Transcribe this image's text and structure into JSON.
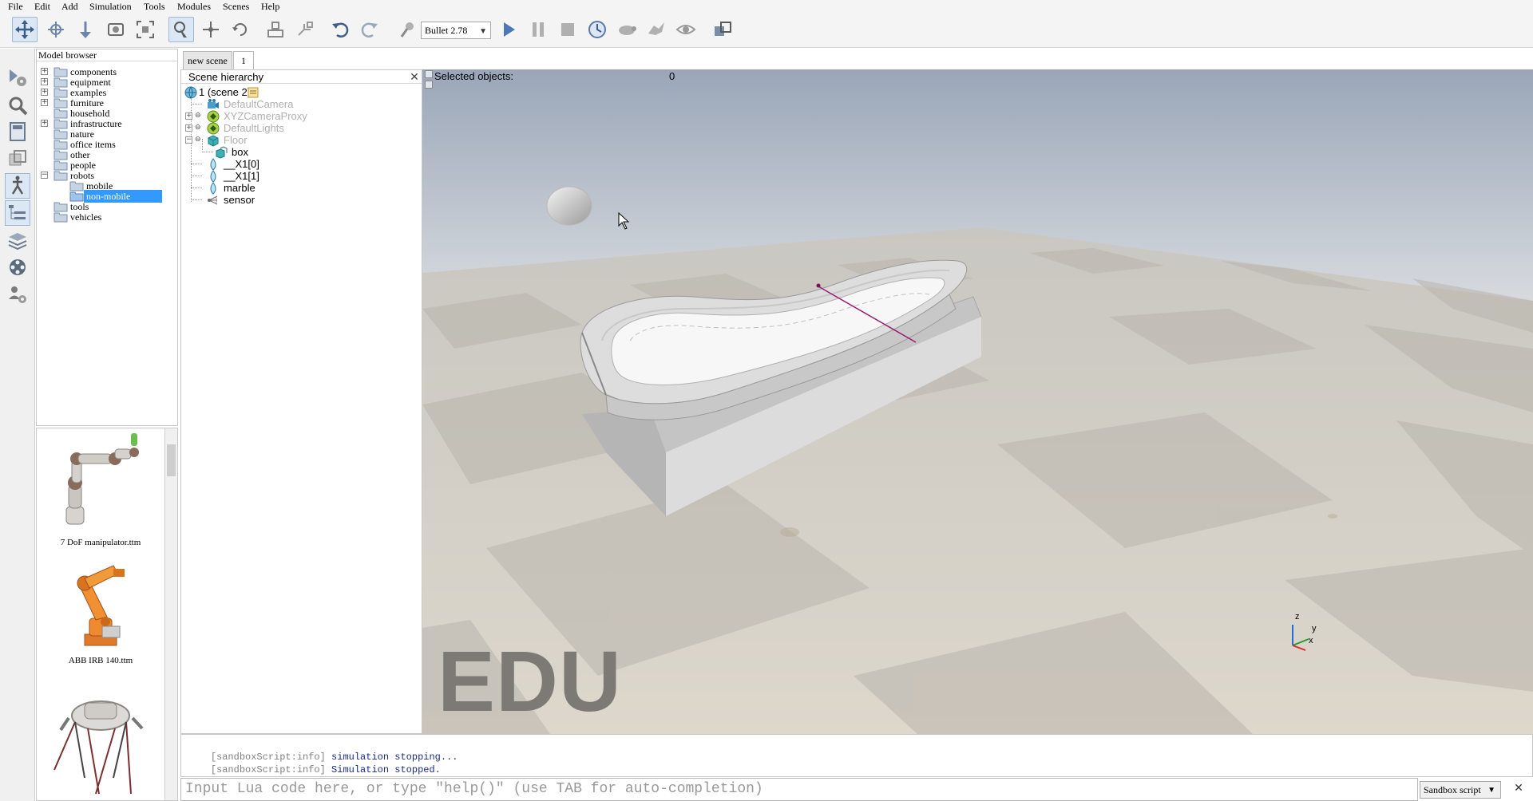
{
  "menu": [
    "File",
    "Edit",
    "Add",
    "Simulation",
    "Tools",
    "Modules",
    "Scenes",
    "Help"
  ],
  "toolbar": {
    "engine": "Bullet 2.78",
    "icons": [
      "camera-pan-icon",
      "camera-rotate-icon",
      "camera-shift-icon",
      "camera-angle-icon",
      "fit-to-view-icon",
      "click-select-icon",
      "object-shift-icon",
      "object-rotate-icon",
      "assemble-icon",
      "transfer-dna-icon",
      "undo-icon",
      "redo-icon",
      "dynamics-settings-icon",
      "start-simulation-icon",
      "pause-simulation-icon",
      "stop-simulation-icon",
      "real-time-icon",
      "slow-down-icon",
      "speed-up-icon",
      "visualization-icon",
      "page-selector-icon"
    ]
  },
  "left_toolbar": [
    "simulation-settings-icon",
    "object-properties-icon",
    "calculation-modules-icon",
    "collections-icon",
    "scripts-icon",
    "shapes-edit-icon",
    "layers-icon",
    "video-recorder-icon",
    "user-settings-icon"
  ],
  "model_browser": {
    "title": "Model browser",
    "folders": [
      {
        "label": "components",
        "expandable": true
      },
      {
        "label": "equipment",
        "expandable": true
      },
      {
        "label": "examples",
        "expandable": true
      },
      {
        "label": "furniture",
        "expandable": true
      },
      {
        "label": "household",
        "expandable": false
      },
      {
        "label": "infrastructure",
        "expandable": true
      },
      {
        "label": "nature",
        "expandable": false
      },
      {
        "label": "office items",
        "expandable": false
      },
      {
        "label": "other",
        "expandable": false
      },
      {
        "label": "people",
        "expandable": false
      },
      {
        "label": "robots",
        "expandable": true,
        "expanded": true
      },
      {
        "label": "mobile",
        "child": true
      },
      {
        "label": "non-mobile",
        "child": true,
        "selected": true
      },
      {
        "label": "tools",
        "expandable": false
      },
      {
        "label": "vehicles",
        "expandable": false
      }
    ],
    "thumbnails": [
      {
        "label": "7 DoF manipulator.ttm"
      },
      {
        "label": "ABB IRB 140.ttm"
      },
      {
        "label": ""
      }
    ]
  },
  "tabs": [
    {
      "label": "new scene",
      "active": false
    },
    {
      "label": "1",
      "active": true
    }
  ],
  "hierarchy": {
    "title": "Scene hierarchy",
    "close": "✕",
    "items": [
      {
        "label": "1 (scene 2)",
        "dim": false
      },
      {
        "label": "DefaultCamera",
        "dim": true
      },
      {
        "label": "XYZCameraProxy",
        "dim": true
      },
      {
        "label": "DefaultLights",
        "dim": true
      },
      {
        "label": "Floor",
        "dim": true
      },
      {
        "label": "box",
        "dim": false
      },
      {
        "label": "__X1[0]",
        "dim": false
      },
      {
        "label": "__X1[1]",
        "dim": false
      },
      {
        "label": "marble",
        "dim": false
      },
      {
        "label": "sensor",
        "dim": false
      }
    ]
  },
  "viewport": {
    "selected_label": "Selected objects:",
    "selected_count": "0",
    "watermark": "EDU",
    "axes": {
      "z": "z",
      "y": "y",
      "x": "x"
    }
  },
  "console": {
    "lines": [
      {
        "tag": "[sandboxScript:info]",
        "msg": "simulation stopping..."
      },
      {
        "tag": "[sandboxScript:info]",
        "msg": "Simulation stopped."
      }
    ],
    "input_placeholder": "Input Lua code here, or type \"help()\" (use TAB for auto-completion)",
    "script_select": "Sandbox script",
    "close": "✕"
  },
  "colors": {
    "selection": "#3399ff",
    "sky_top": "#9aa6b8",
    "sky_bottom": "#d9dce0",
    "floor_light": "#e3ddd3",
    "floor_dark": "#cdc7bb",
    "sensor_line": "#9b1d6e"
  }
}
